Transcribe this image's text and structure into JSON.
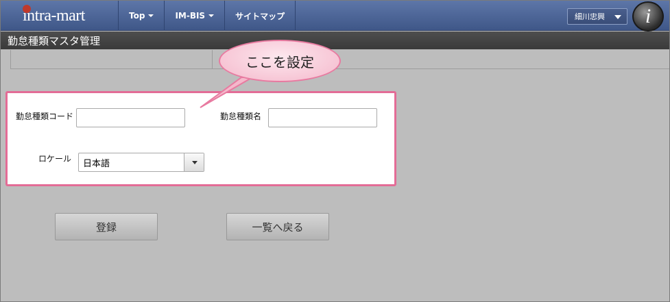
{
  "header": {
    "logo_text": "intra-mart",
    "nav": [
      {
        "label": "Top",
        "has_menu": true
      },
      {
        "label": "IM-BIS",
        "has_menu": true
      },
      {
        "label": "サイトマップ",
        "has_menu": false
      }
    ],
    "user_name": "細川忠興",
    "help_glyph": "i"
  },
  "page": {
    "title": "勤怠種類マスタ管理"
  },
  "callout": {
    "text": "ここを設定"
  },
  "form": {
    "code_label": "勤怠種類コード",
    "code_value": "",
    "name_label": "勤怠種類名",
    "name_value": "",
    "locale_label": "ロケール",
    "locale_value": "日本語"
  },
  "buttons": {
    "register": "登録",
    "back_to_list": "一覧へ戻る"
  },
  "colors": {
    "header_blue": "#4a6396",
    "highlight_pink": "#e36c96",
    "callout_fill": "#f4b8cb"
  }
}
